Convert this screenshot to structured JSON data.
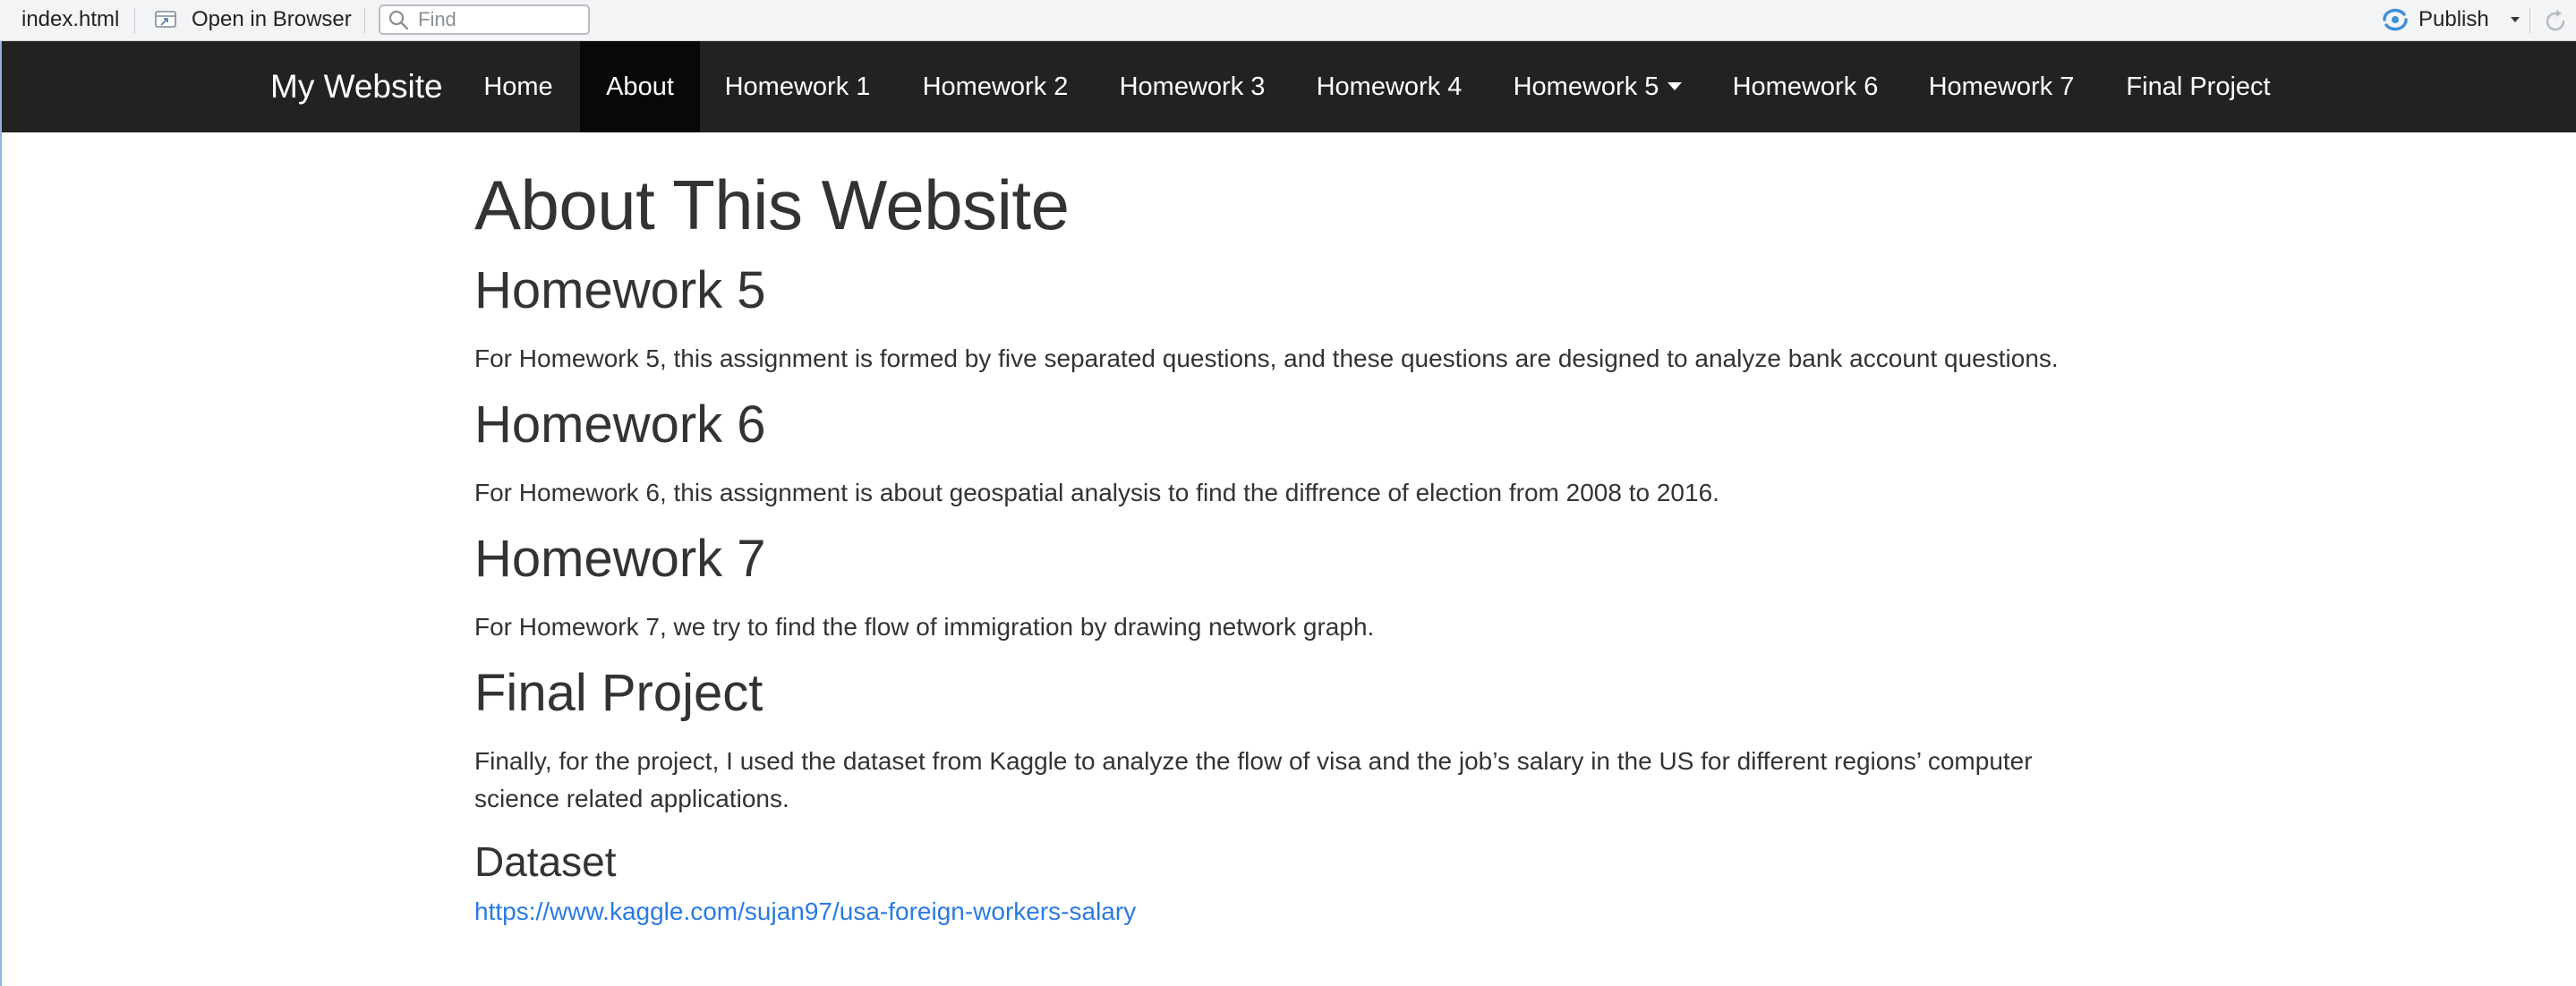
{
  "toolbar": {
    "file_name": "index.html",
    "open_in_browser_label": "Open in Browser",
    "find_placeholder": "Find",
    "publish_label": "Publish"
  },
  "navbar": {
    "brand": "My Website",
    "items": [
      {
        "label": "Home",
        "active": false
      },
      {
        "label": "About",
        "active": true
      },
      {
        "label": "Homework 1",
        "active": false
      },
      {
        "label": "Homework 2",
        "active": false
      },
      {
        "label": "Homework 3",
        "active": false
      },
      {
        "label": "Homework 4",
        "active": false
      },
      {
        "label": "Homework 5",
        "active": false,
        "dropdown": true
      },
      {
        "label": "Homework 6",
        "active": false
      },
      {
        "label": "Homework 7",
        "active": false
      },
      {
        "label": "Final Project",
        "active": false
      }
    ]
  },
  "content": {
    "title": "About This Website",
    "sections": [
      {
        "heading": "Homework 5",
        "text": "For Homework 5, this assignment is formed by five separated questions, and these questions are designed to analyze bank account questions."
      },
      {
        "heading": "Homework 6",
        "text": "For Homework 6, this assignment is about geospatial analysis to find the diffrence of election from 2008 to 2016."
      },
      {
        "heading": "Homework 7",
        "text": "For Homework 7, we try to find the flow of immigration by drawing network graph."
      },
      {
        "heading": "Final Project",
        "text": "Finally, for the project, I used the dataset from Kaggle to analyze the flow of visa and the job’s salary in the US for different regions’ computer science related applications."
      }
    ],
    "dataset": {
      "heading": "Dataset",
      "link_text": "https://www.kaggle.com/sujan97/usa-foreign-workers-salary",
      "link_href": "https://www.kaggle.com/sujan97/usa-foreign-workers-salary"
    }
  },
  "colors": {
    "navbar_bg": "#222222",
    "navbar_active_bg": "#080808",
    "text": "#333333",
    "link": "#2a7ae2",
    "publish_icon": "#3d8fd6"
  },
  "icons": {
    "open_in_browser": "open-in-browser-icon",
    "find": "search-icon",
    "publish": "publish-icon",
    "publish_menu": "chevron-down-icon",
    "refresh": "refresh-icon",
    "homework5_menu": "caret-down-icon"
  }
}
